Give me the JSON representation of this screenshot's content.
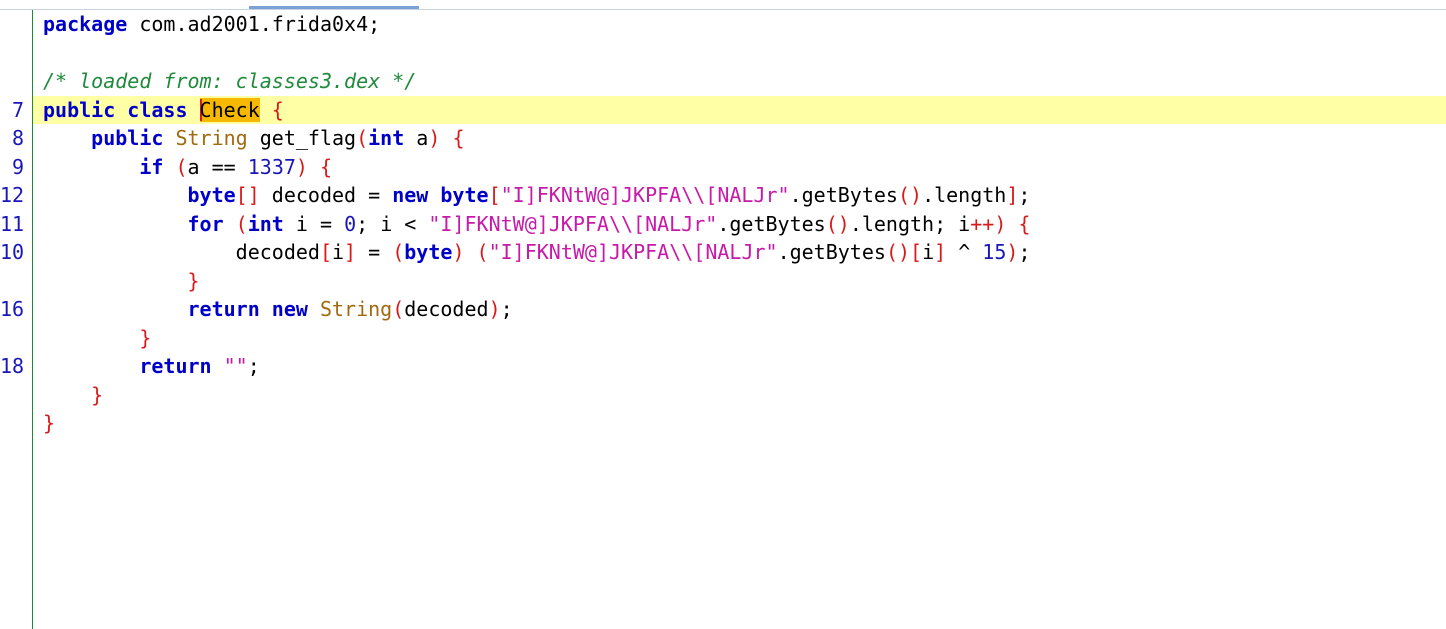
{
  "gutter": {
    "line_numbers": [
      "7",
      "8",
      "9",
      "12",
      "11",
      "10",
      "16",
      "18"
    ]
  },
  "code": {
    "package_kw": "package",
    "package_name": " com.ad2001.frida0x4;",
    "comment": "/* loaded from: classes3.dex */",
    "class_kw": "public class ",
    "class_name": "Check",
    "class_open": " {",
    "method_public": "public",
    "method_string": "String",
    "method_name": " get_flag",
    "method_paren_open": "(",
    "method_int": "int",
    "method_param": " a",
    "method_paren_close": ")",
    "method_brace": " {",
    "if_kw": "if",
    "if_open": " (",
    "if_cond": "a == ",
    "if_num": "1337",
    "if_close": ")",
    "if_brace": " {",
    "byte_kw": "byte",
    "byte_brackets": "[]",
    "decoded_decl": " decoded = ",
    "new_kw": "new",
    "byte_kw2": " byte",
    "lbracket": "[",
    "str_literal": "\"I]FKNtW@]JKPFA\\\\[NALJr\"",
    "getbytes_len": ".getBytes",
    "parens": "()",
    "length": ".length",
    "rbracket_semi_br": "]",
    "semi": ";",
    "for_kw": "for",
    "for_open": " (",
    "for_int": "int",
    "for_init": " i = ",
    "for_zero": "0",
    "for_cond": "; i < ",
    "for_length_tail": ".length; i",
    "for_inc": "++",
    "for_close": ")",
    "for_brace": " {",
    "assign_lhs": "decoded",
    "assign_idx_open": "[",
    "assign_idx": "i",
    "assign_idx_close": "]",
    "assign_eq": " = ",
    "cast_open": "(",
    "cast_byte": "byte",
    "cast_close": ")",
    "paren_open": " (",
    "getbytes": ".getBytes",
    "idx_open": "[",
    "idx_i": "i",
    "idx_close": "]",
    "xor": " ^ ",
    "xor_num": "15",
    "paren_close": ")",
    "close_brace": "}",
    "return_kw": "return",
    "new_kw2": " new",
    "string_type": " String",
    "ret_paren_open": "(",
    "ret_arg": "decoded",
    "ret_paren_close": ")",
    "return_empty": " \"\"",
    "semi2": ";"
  },
  "colors": {
    "keyword": "#0000c8",
    "type": "#a06a10",
    "string": "#c81aa8",
    "number": "#1a17b8",
    "bracket": "#d91a1a",
    "comment": "#1f8a3b",
    "current_line": "#ffffa5",
    "highlight_word": "#f7b800"
  }
}
